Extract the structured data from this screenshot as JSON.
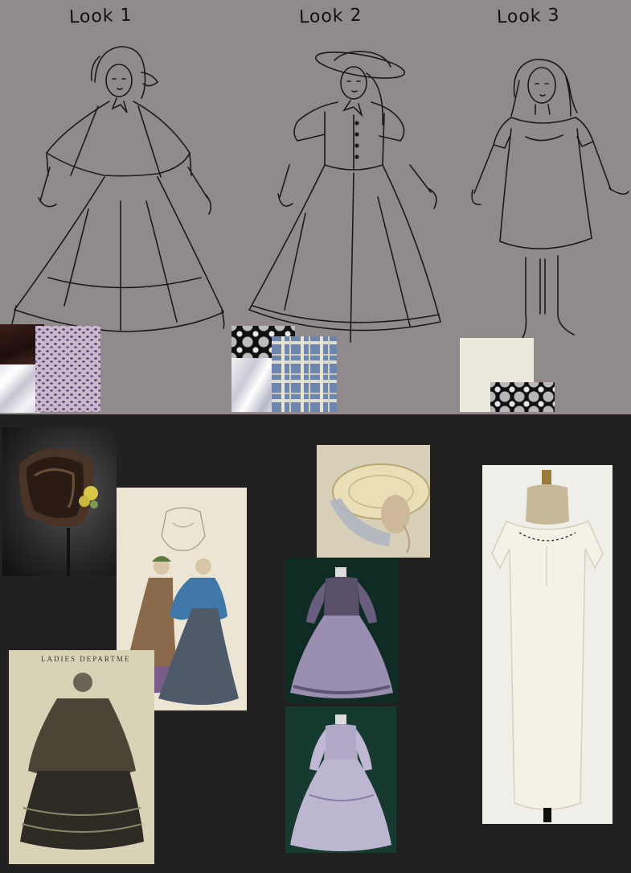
{
  "looks": [
    {
      "title": "Look 1"
    },
    {
      "title": "Look 2"
    },
    {
      "title": "Look 3"
    }
  ],
  "print_ladies": {
    "header": "LADIES DEPARTME"
  },
  "colors": {
    "top_panel": "#918a8c",
    "bottom_panel": "#222121",
    "sketch_line": "#1a1a1a",
    "lilac_fabric": "#8c789a",
    "plaid_blue": "#6f86ac",
    "cream": "#ece8de"
  }
}
